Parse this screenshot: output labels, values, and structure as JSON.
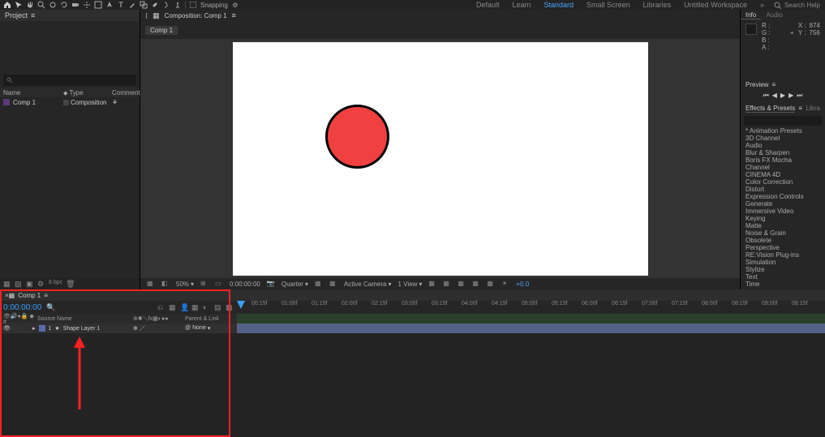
{
  "topbar": {
    "snapping_label": "Snapping",
    "workspaces": [
      "Default",
      "Learn",
      "Standard",
      "Small Screen",
      "Libraries",
      "Untitled Workspace"
    ],
    "active_ws": 2,
    "search_placeholder": "Search Help"
  },
  "project": {
    "tab": "Project",
    "search_placeholder": "",
    "columns": [
      "Name",
      "Type",
      "Comment"
    ],
    "items": [
      {
        "name": "Comp 1",
        "type": "Composition"
      }
    ],
    "footer_bpc": "8 bpc"
  },
  "composition": {
    "panel_label": "Composition: Comp 1",
    "active_tab": "Comp 1",
    "viewer_bar": {
      "zoom": "50%",
      "timecode": "0:00:00:00",
      "resolution": "Quarter",
      "camera": "Active Camera",
      "views": "1 View",
      "exposure": "+0.0"
    }
  },
  "info": {
    "tabs": [
      "Info",
      "Audio"
    ],
    "R": "",
    "G": "",
    "B": "",
    "A": "",
    "X": "874",
    "Y": "756",
    "plus": "+"
  },
  "preview": {
    "title": "Preview"
  },
  "effects": {
    "title": "Effects & Presets",
    "other_tab": "Libra",
    "items": [
      "* Animation Presets",
      "3D Channel",
      "Audio",
      "Blur & Sharpen",
      "Boris FX Mocha",
      "Channel",
      "CINEMA 4D",
      "Color Correction",
      "Distort",
      "Expression Controls",
      "Generate",
      "Immersive Video",
      "Keying",
      "Matte",
      "Noise & Grain",
      "Obsolete",
      "Perspective",
      "RE:Vision Plug-ins",
      "Simulation",
      "Stylize",
      "Text",
      "Time"
    ]
  },
  "timeline": {
    "tab": "Comp 1",
    "timecode": "0:00:00:00",
    "col_left": [
      "",
      "Source Name",
      "",
      "Parent & Link"
    ],
    "mode_labels": "",
    "layer": {
      "num": "1",
      "name": "Shape Layer 1",
      "parent": "None"
    },
    "ticks": [
      "00:15f",
      "01:00f",
      "01:15f",
      "02:00f",
      "02:15f",
      "03:00f",
      "03:15f",
      "04:00f",
      "04:15f",
      "05:00f",
      "05:15f",
      "06:00f",
      "06:15f",
      "07:00f",
      "07:15f",
      "08:00f",
      "08:15f",
      "09:00f",
      "09:15f"
    ]
  }
}
